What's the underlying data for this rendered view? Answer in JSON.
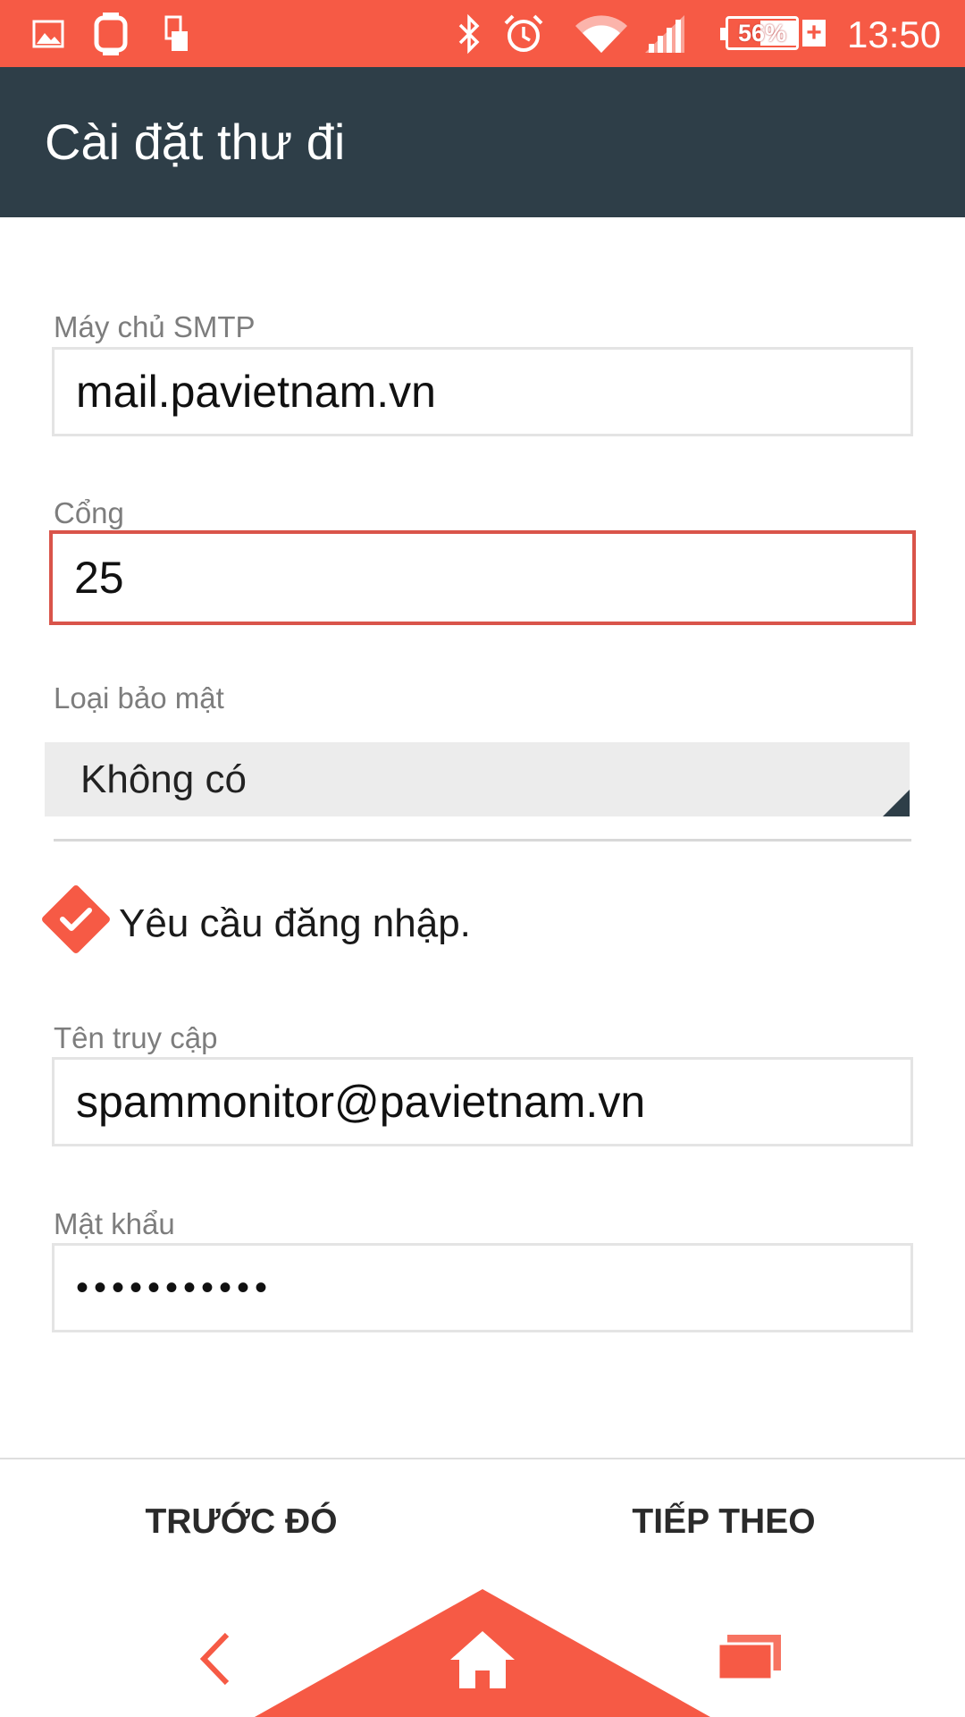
{
  "status_bar": {
    "icons": [
      "image-icon",
      "smartwatch-icon",
      "phone-device-icon",
      "bluetooth-icon",
      "alarm-icon",
      "wifi-icon",
      "signal-icon"
    ],
    "battery_percent": "56%",
    "charging_symbol": "+",
    "time": "13:50",
    "background_color": "#f65a45"
  },
  "app_bar": {
    "title": "Cài đặt thư đi",
    "background_color": "#2e3e48"
  },
  "form": {
    "smtp_server": {
      "label": "Máy chủ SMTP",
      "value": "mail.pavietnam.vn"
    },
    "port": {
      "label": "Cổng",
      "value": "25"
    },
    "security_type": {
      "label": "Loại bảo mật",
      "selected": "Không có"
    },
    "require_login": {
      "label": "Yêu cầu đăng nhập.",
      "checked": true
    },
    "username": {
      "label": "Tên truy cập",
      "value": "spammonitor@pavietnam.vn"
    },
    "password": {
      "label": "Mật khẩu",
      "masked_value": "•••••••••••"
    }
  },
  "actions": {
    "previous_label": "TRƯỚC ĐÓ",
    "next_label": "TIẾP THEO"
  },
  "nav_bar": {
    "icons": [
      "back-icon",
      "home-icon",
      "recent-apps-icon"
    ],
    "accent_color": "#f65a45"
  }
}
